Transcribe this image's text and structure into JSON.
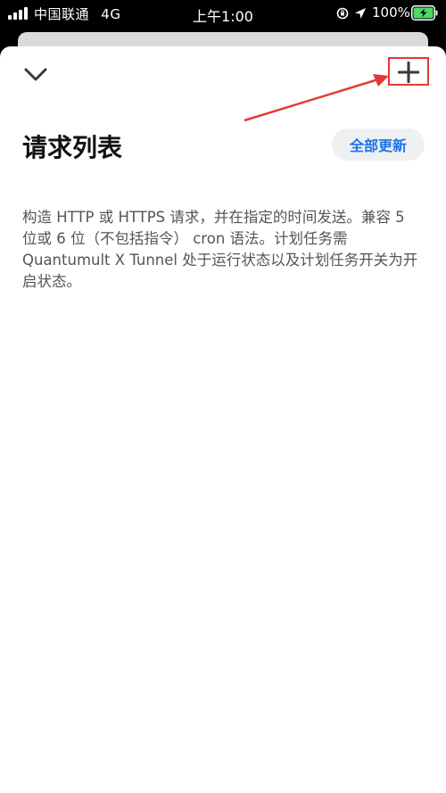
{
  "status_bar": {
    "carrier": "中国联通",
    "network": "4G",
    "time": "上午1:00",
    "battery": "100%"
  },
  "header": {
    "title": "请求列表",
    "update_all_label": "全部更新",
    "collapse_icon": "chevron-down-icon",
    "add_icon": "plus-icon"
  },
  "description": "构造 HTTP 或 HTTPS 请求，并在指定的时间发送。兼容 5 位或 6 位（不包括指令） cron 语法。计划任务需 Quantumult X Tunnel 处于运行状态以及计划任务开关为开启状态。",
  "colors": {
    "accent": "#1a73e8",
    "annotation": "#e53935",
    "battery": "#4cd964"
  }
}
